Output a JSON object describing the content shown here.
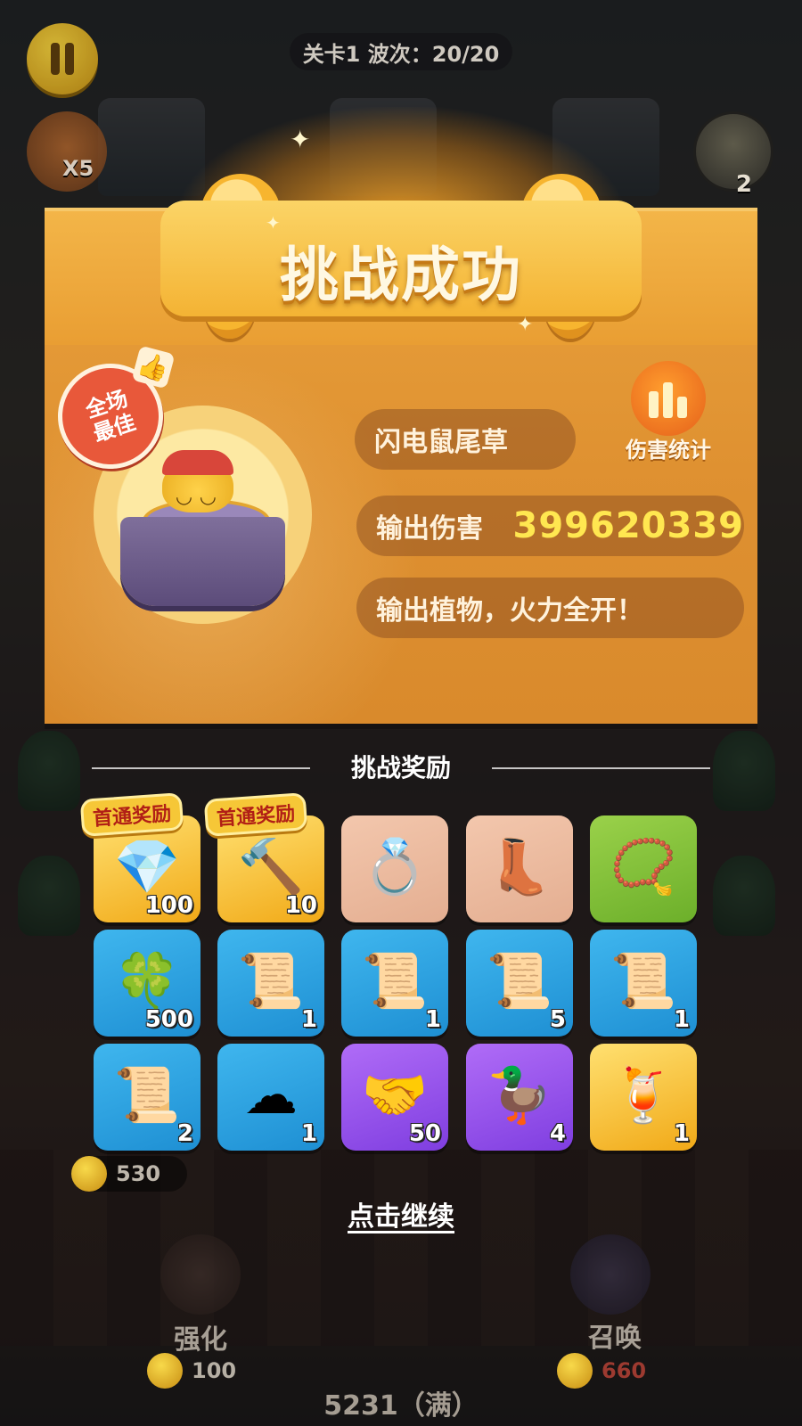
{
  "hud": {
    "level_wave": "关卡1 波次：20/20",
    "speed_multiplier": "X5",
    "hero_count": "2",
    "coins": "530",
    "upgrade_label": "强化",
    "upgrade_cost": "100",
    "summon_label": "召唤",
    "summon_cost": "660",
    "bottom_status": "5231（满）"
  },
  "result": {
    "title": "挑战成功",
    "mvp_badge": "全场最佳",
    "plant_name": "闪电鼠尾草",
    "damage_label": "输出伤害",
    "damage_value": "399620339",
    "quote": "输出植物，火力全开！",
    "stats_label": "伤害统计"
  },
  "rewards": {
    "title": "挑战奖励",
    "first_clear_tag": "首通奖励",
    "continue_label": "点击继续",
    "items": [
      {
        "icon": "red-gem-icon",
        "glyph": "💎",
        "qty": "100",
        "bg": "gold",
        "first_clear": true
      },
      {
        "icon": "hammer-icon",
        "glyph": "🔨",
        "qty": "10",
        "bg": "gold",
        "first_clear": true
      },
      {
        "icon": "ring-icon",
        "glyph": "💍",
        "qty": "",
        "bg": "tan",
        "first_clear": false
      },
      {
        "icon": "boots-icon",
        "glyph": "👢",
        "qty": "",
        "bg": "tan",
        "first_clear": false
      },
      {
        "icon": "amulet-icon",
        "glyph": "📿",
        "qty": "",
        "bg": "green",
        "first_clear": false
      },
      {
        "icon": "clover-coin-icon",
        "glyph": "🍀",
        "qty": "500",
        "bg": "blue",
        "first_clear": false
      },
      {
        "icon": "helmet-scroll-icon",
        "glyph": "📜",
        "qty": "1",
        "bg": "blue",
        "first_clear": false
      },
      {
        "icon": "armor-scroll-icon",
        "glyph": "📜",
        "qty": "1",
        "bg": "blue",
        "first_clear": false
      },
      {
        "icon": "sword-scroll-icon",
        "glyph": "📜",
        "qty": "5",
        "bg": "blue",
        "first_clear": false
      },
      {
        "icon": "ring-scroll-icon",
        "glyph": "📜",
        "qty": "1",
        "bg": "blue",
        "first_clear": false
      },
      {
        "icon": "amulet-scroll-icon",
        "glyph": "📜",
        "qty": "2",
        "bg": "blue",
        "first_clear": false
      },
      {
        "icon": "cloud-icon",
        "glyph": "☁",
        "qty": "1",
        "bg": "blue",
        "first_clear": false
      },
      {
        "icon": "handshake-medal-icon",
        "glyph": "🤝",
        "qty": "50",
        "bg": "purple",
        "first_clear": false
      },
      {
        "icon": "rubber-duck-icon",
        "glyph": "🦆",
        "qty": "4",
        "bg": "purple",
        "first_clear": false
      },
      {
        "icon": "drink-icon",
        "glyph": "🍹",
        "qty": "1",
        "bg": "gold",
        "first_clear": false
      }
    ]
  },
  "colors": {
    "panel": "#e09432",
    "damage_value": "#ffe750",
    "mvp_badge": "#e8583a"
  }
}
